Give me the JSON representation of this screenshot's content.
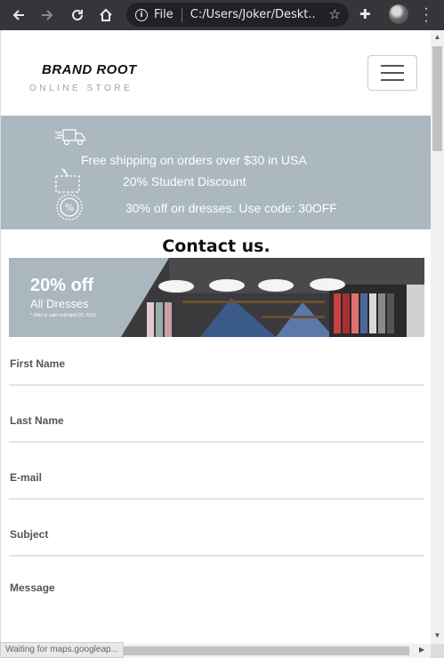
{
  "browser": {
    "back_icon": "arrow-left-icon",
    "forward_icon": "arrow-right-icon",
    "reload_icon": "reload-icon",
    "home_icon": "home-icon",
    "scheme_label": "File",
    "url": "C:/Users/Joker/Deskt...",
    "status_text": "Waiting for maps.googleap..."
  },
  "header": {
    "brand_name": "BRAND ROOT",
    "brand_tagline": "ONLINE STORE"
  },
  "promo": {
    "items": [
      {
        "icon": "delivery-truck-icon",
        "text": "Free shipping on orders over $30 in USA"
      },
      {
        "icon": "gift-box-icon",
        "text": "20% Student Discount"
      },
      {
        "icon": "percent-badge-icon",
        "text": "30% off on dresses. Use code: 30OFF"
      }
    ],
    "background_color": "#abb8bf"
  },
  "contact": {
    "title": "Contact us."
  },
  "banner": {
    "headline": "20% off",
    "subline": "All Dresses",
    "note": "* Offer is valid until April 20, 2019"
  },
  "form": {
    "fields": [
      {
        "label": "First Name"
      },
      {
        "label": "Last Name"
      },
      {
        "label": "E-mail"
      },
      {
        "label": "Subject"
      },
      {
        "label": "Message"
      }
    ]
  }
}
